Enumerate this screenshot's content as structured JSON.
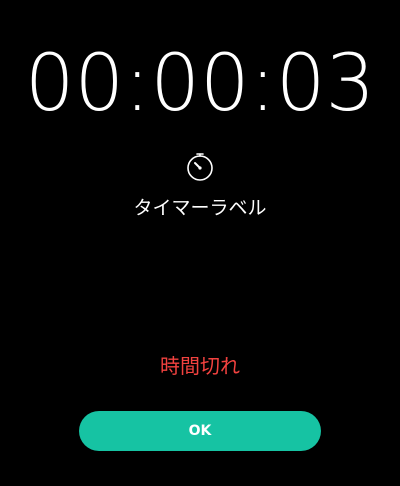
{
  "timer": {
    "elapsed": "00:00:03",
    "label": "タイマーラベル",
    "status": "時間切れ",
    "icon": "stopwatch-icon"
  },
  "actions": {
    "ok_label": "OK"
  },
  "colors": {
    "background": "#000000",
    "text": "#ffffff",
    "status": "#f2423f",
    "accent": "#16c3a3"
  }
}
